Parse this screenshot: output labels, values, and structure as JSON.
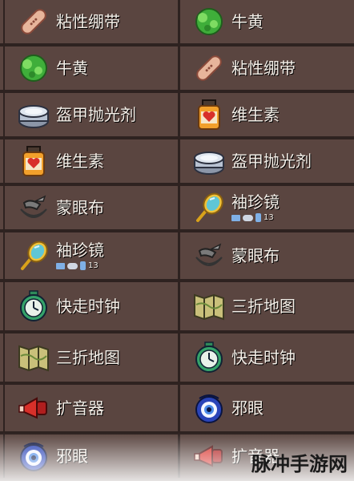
{
  "rows": [
    {
      "left": {
        "label": "粘性绷带",
        "icon": "bandage-icon"
      },
      "right": {
        "label": "牛黄",
        "icon": "bezoar-icon"
      }
    },
    {
      "left": {
        "label": "牛黄",
        "icon": "bezoar-icon"
      },
      "right": {
        "label": "粘性绷带",
        "icon": "bandage-icon"
      }
    },
    {
      "left": {
        "label": "盔甲抛光剂",
        "icon": "armor-polish-icon"
      },
      "right": {
        "label": "维生素",
        "icon": "vitamins-icon"
      }
    },
    {
      "left": {
        "label": "维生素",
        "icon": "vitamins-icon"
      },
      "right": {
        "label": "盔甲抛光剂",
        "icon": "armor-polish-icon"
      }
    },
    {
      "left": {
        "label": "蒙眼布",
        "icon": "blindfold-icon"
      },
      "right": {
        "label": "袖珍镜",
        "icon": "pocket-mirror-icon",
        "platform_count": "13"
      }
    },
    {
      "left": {
        "label": "袖珍镜",
        "icon": "pocket-mirror-icon",
        "platform_count": "13"
      },
      "right": {
        "label": "蒙眼布",
        "icon": "blindfold-icon"
      }
    },
    {
      "left": {
        "label": "快走时钟",
        "icon": "fast-clock-icon"
      },
      "right": {
        "label": "三折地图",
        "icon": "trifold-map-icon"
      }
    },
    {
      "left": {
        "label": "三折地图",
        "icon": "trifold-map-icon"
      },
      "right": {
        "label": "快走时钟",
        "icon": "fast-clock-icon"
      }
    },
    {
      "left": {
        "label": "扩音器",
        "icon": "megaphone-icon"
      },
      "right": {
        "label": "邪眼",
        "icon": "evil-eye-icon"
      }
    },
    {
      "left": {
        "label": "邪眼",
        "icon": "evil-eye-icon"
      },
      "right": {
        "label": "扩音器",
        "icon": "megaphone-icon"
      }
    }
  ],
  "watermark": "脉冲手游网"
}
